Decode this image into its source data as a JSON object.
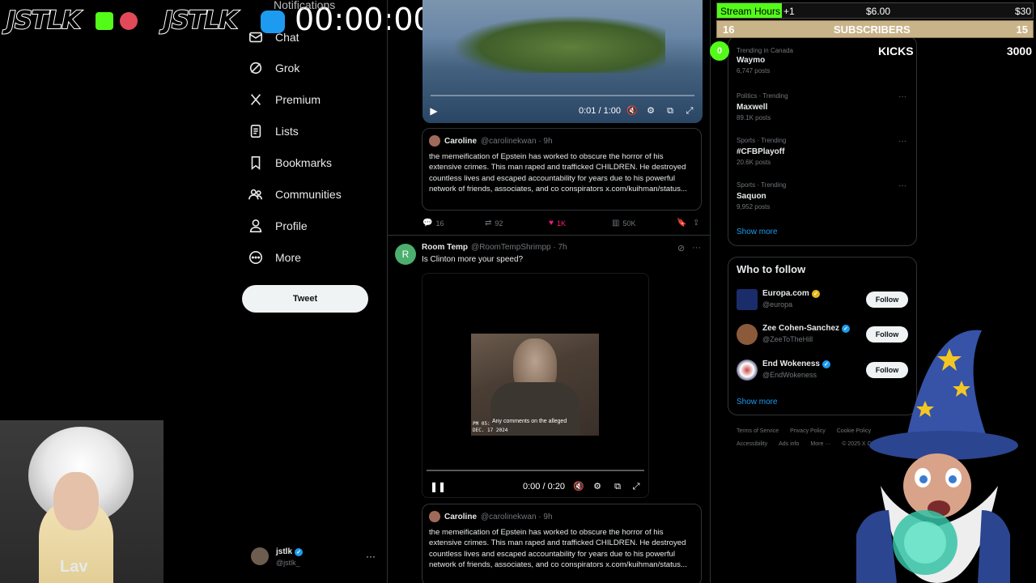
{
  "overlay": {
    "brand_left": "JSTLK",
    "brand_right": "JSTLK",
    "timer": "00:00:00"
  },
  "nav": {
    "notifications": "Notifications",
    "chat": "Chat",
    "grok": "Grok",
    "premium": "Premium",
    "lists": "Lists",
    "bookmarks": "Bookmarks",
    "communities": "Communities",
    "profile": "Profile",
    "more": "More",
    "tweet_button": "Tweet"
  },
  "video1": {
    "time": "0:01 / 1:00"
  },
  "quote1": {
    "name": "Caroline",
    "handle": "@carolinekwan · 9h",
    "text": "the memeification of Epstein has worked to obscure the horror of his extensive crimes. This man raped and trafficked CHILDREN. He destroyed countless lives and escaped accountability for years due to his powerful network of friends, associates, and co conspirators x.com/kuihman/status..."
  },
  "actions1": {
    "replies": "16",
    "reposts": "92",
    "likes": "1K",
    "views": "50K"
  },
  "post2": {
    "avatar_letter": "R",
    "name": "Room Temp",
    "handle": "@RoomTempShrimpp · 7h",
    "text": "Is Clinton more your speed?"
  },
  "video2": {
    "caption": "Any comments on the alleged",
    "date_line1": "PM 05:",
    "date_line2": "DEC. 17 2024",
    "time": "0:00 / 0:20"
  },
  "quote2": {
    "name": "Caroline",
    "handle": "@carolinekwan · 9h",
    "text": "the memeification of Epstein has worked to obscure the horror of his extensive crimes. This man raped and trafficked CHILDREN. He destroyed countless lives and escaped accountability for years due to his powerful network of friends, associates, and co conspirators x.com/kuihman/status..."
  },
  "trends": [
    {
      "context": "Trending in Canada",
      "title": "Waymo",
      "count": "6,747 posts"
    },
    {
      "context": "Politics · Trending",
      "title": "Maxwell",
      "count": "89.1K posts"
    },
    {
      "context": "Sports · Trending",
      "title": "#CFBPlayoff",
      "count": "20.6K posts"
    },
    {
      "context": "Sports · Trending",
      "title": "Saquon",
      "count": "9,952 posts"
    }
  ],
  "show_more": "Show more",
  "who_to_follow": {
    "title": "Who to follow",
    "accounts": [
      {
        "name": "Europa.com",
        "handle": "@europa",
        "badge_color": "#e2b719"
      },
      {
        "name": "Zee Cohen-Sanchez",
        "handle": "@ZeeToTheHill",
        "badge_color": "#1d9bf0"
      },
      {
        "name": "End Wokeness",
        "handle": "@EndWokeness",
        "badge_color": "#1d9bf0"
      }
    ],
    "follow_label": "Follow",
    "show_more": "Show more"
  },
  "footer": {
    "line1": [
      "Terms of Service",
      "Privacy Policy",
      "Cookie Policy"
    ],
    "line2": [
      "Accessibility",
      "Ads info",
      "More ···",
      "© 2025 X Co"
    ]
  },
  "stream": {
    "hours_label": "Stream Hours",
    "hours_increment": "+1",
    "hours_price": "$6.00",
    "hours_goal": "$30",
    "subs_left": "16",
    "subs_label": "SUBSCRIBERS",
    "subs_right": "15",
    "kicks_count": "0",
    "kicks_label": "KICKS",
    "kicks_goal": "3000",
    "accent": "#53fc18"
  },
  "webcam": {
    "name": "Lav"
  },
  "account": {
    "name": "jstlk",
    "handle": "@jstlk_"
  }
}
